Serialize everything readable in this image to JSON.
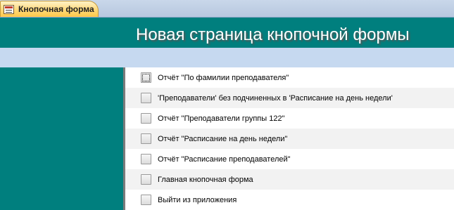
{
  "tab": {
    "label": "Кнопочная форма",
    "icon": "form-icon"
  },
  "header": {
    "title": "Новая страница кнопочной формы"
  },
  "colors": {
    "teal": "#007f7e",
    "band": "#c6d9f0",
    "tab": "#ffd97a"
  },
  "items": [
    {
      "label": "Отчёт \"По фамилии преподавателя\""
    },
    {
      "label": "'Преподаватели' без подчиненных в 'Расписание на день недели'"
    },
    {
      "label": "Отчёт \"Преподаватели группы 122\""
    },
    {
      "label": "Отчёт \"Расписание на день недели\""
    },
    {
      "label": "Отчёт \"Расписание преподавателей\""
    },
    {
      "label": "Главная кнопочная форма"
    },
    {
      "label": "Выйти из приложения"
    }
  ]
}
